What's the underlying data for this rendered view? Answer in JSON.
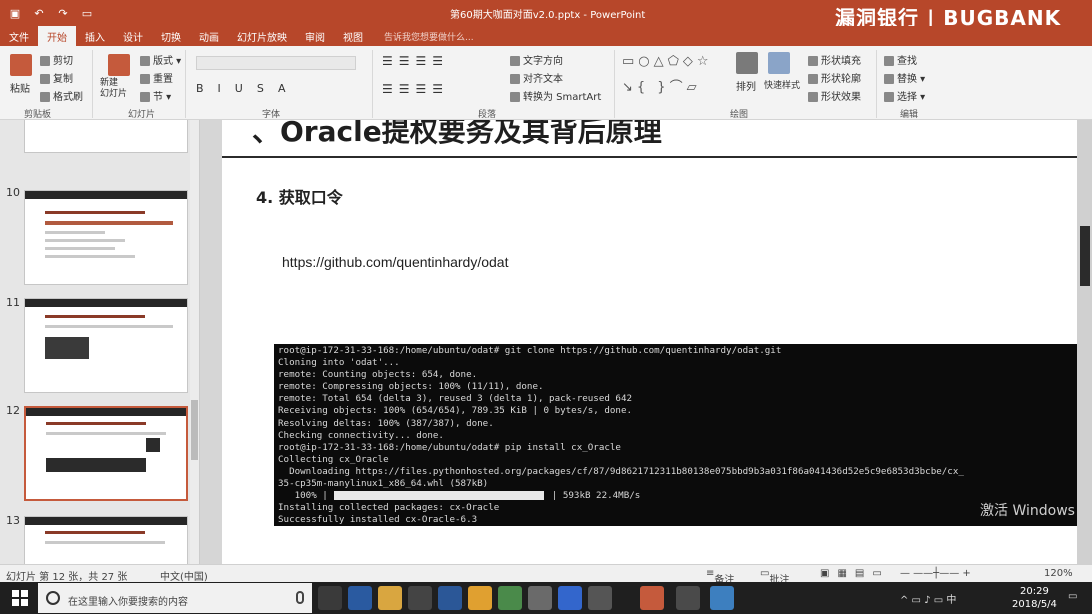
{
  "window": {
    "title": "第60期大咖面对面v2.0.pptx - PowerPoint",
    "brand": "漏洞银行 | BUGBANK"
  },
  "tabs": [
    "文件",
    "开始",
    "插入",
    "设计",
    "切换",
    "动画",
    "幻灯片放映",
    "审阅",
    "视图"
  ],
  "active_tab": "开始",
  "tell_me": "告诉我您想要做什么...",
  "ribbon": {
    "clipboard": {
      "paste": "粘贴",
      "cut": "剪切",
      "copy": "复制",
      "format_painter": "格式刷",
      "group": "剪贴板"
    },
    "slides": {
      "new_slide": "新建\n幻灯片",
      "layout": "版式",
      "reset": "重置",
      "section": "节",
      "group": "幻灯片"
    },
    "font": {
      "group": "字体"
    },
    "paragraph": {
      "text_direction": "文字方向",
      "align_text": "对齐文本",
      "convert_smartart": "转换为 SmartArt",
      "group": "段落"
    },
    "drawing": {
      "arrange": "排列",
      "quick_styles": "快速样式",
      "shape_fill": "形状填充",
      "shape_outline": "形状轮廓",
      "shape_effects": "形状效果",
      "group": "绘图"
    },
    "editing": {
      "find": "查找",
      "replace": "替换",
      "select": "选择",
      "group": "编辑"
    }
  },
  "thumbnails": [
    {
      "number": "10",
      "selected": false
    },
    {
      "number": "11",
      "selected": false
    },
    {
      "number": "12",
      "selected": true,
      "label": "Oracle提权要务及其背后原理"
    },
    {
      "number": "13",
      "selected": false
    }
  ],
  "slide": {
    "title": "、Oracle提权要务及其背后原理",
    "subtitle": "4. 获取口令",
    "link": "https://github.com/quentinhardy/odat"
  },
  "terminal": {
    "lines": [
      "root@ip-172-31-33-168:/home/ubuntu/odat# git clone https://github.com/quentinhardy/odat.git",
      "Cloning into 'odat'...",
      "remote: Counting objects: 654, done.",
      "remote: Compressing objects: 100% (11/11), done.",
      "remote: Total 654 (delta 3), reused 3 (delta 1), pack-reused 642",
      "Receiving objects: 100% (654/654), 789.35 KiB | 0 bytes/s, done.",
      "Resolving deltas: 100% (387/387), done.",
      "Checking connectivity... done.",
      "root@ip-172-31-33-168:/home/ubuntu/odat# pip install cx_Oracle",
      "Collecting cx_Oracle",
      "  Downloading https://files.pythonhosted.org/packages/cf/87/9d8621712311b80138e075bbd9b3a031f86a041436d52e5c9e6853d3bcbe/cx_",
      "35-cp35m-manylinux1_x86_64.whl (587kB)"
    ],
    "progress_prefix": "   100% |",
    "progress_suffix": "| 593kB 22.4MB/s",
    "tail": [
      "Installing collected packages: cx-Oracle",
      "Successfully installed cx-Oracle-6.3"
    ]
  },
  "watermark": "激活 Windows",
  "status": {
    "slide_info": "幻灯片 第 12 张，共 27 张",
    "language": "中文(中国)",
    "notes": "备注",
    "comments": "批注",
    "zoom": "120%"
  },
  "taskbar": {
    "search_placeholder": "在这里输入你要搜索的内容",
    "time": "20:29",
    "date": "2018/5/4"
  },
  "colors": {
    "accent": "#b7472a",
    "terminal_bg": "#0b0b0b"
  }
}
